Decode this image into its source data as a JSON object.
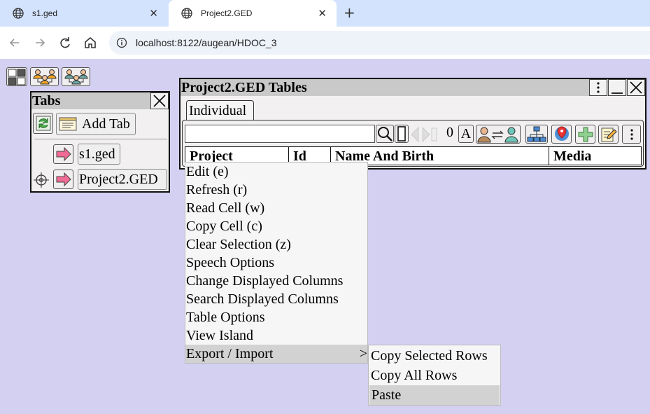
{
  "browser": {
    "tabs": [
      {
        "title": "s1.ged",
        "active": false
      },
      {
        "title": "Project2.GED",
        "active": true
      }
    ],
    "url": "localhost:8122/augean/HDOC_3"
  },
  "tabs_panel": {
    "title": "Tabs",
    "add_tab_label": "Add Tab",
    "items": [
      {
        "label": "s1.ged",
        "current": false
      },
      {
        "label": "Project2.GED",
        "current": true
      }
    ]
  },
  "tables_panel": {
    "title": "Project2.GED Tables",
    "tab": "Individual",
    "search_value": "",
    "row_count": "0",
    "text_button": "A",
    "columns": [
      "Project",
      "Id",
      "Name And Birth",
      "Media"
    ]
  },
  "context_menu": {
    "items": [
      "Edit (e)",
      "Refresh (r)",
      "Read Cell (w)",
      "Copy Cell (c)",
      "Clear Selection (z)",
      "Speech Options",
      "Change Displayed Columns",
      "Search Displayed Columns",
      "Table Options",
      "View Island",
      "Export / Import"
    ],
    "submenu_arrow": ">",
    "submenu": [
      "Copy Selected Rows",
      "Copy All Rows",
      "Paste"
    ]
  },
  "colors": {
    "background": "#d3d0f1",
    "chrome_tabbar": "#d3e3fd",
    "title_bar": "#c9c9c9",
    "arrow_pink": "#f06a95",
    "highlight": "#d2d2d2"
  }
}
